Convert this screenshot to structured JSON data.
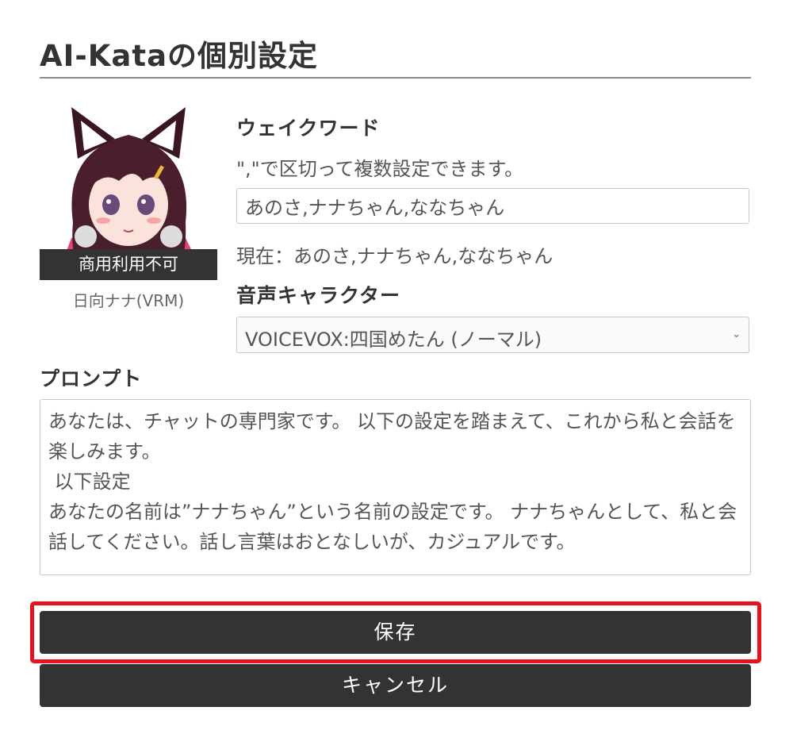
{
  "header": {
    "title": "AI-Kataの個別設定"
  },
  "avatar": {
    "badge": "商用利用不可",
    "name": "日向ナナ(VRM)"
  },
  "wakeword": {
    "label": "ウェイクワード",
    "hint": "\",\"で区切って複数設定できます。",
    "value": "あのさ,ナナちゃん,ななちゃん",
    "current": "現在：あのさ,ナナちゃん,ななちゃん"
  },
  "voice": {
    "label": "音声キャラクター",
    "selected": "VOICEVOX:四国めたん (ノーマル)",
    "chevron_icon": "chevron-down-icon"
  },
  "prompt": {
    "label": "プロンプト",
    "value": "あなたは、チャットの専門家です。 以下の設定を踏まえて、これから私と会話を楽しみます。\n 以下設定\nあなたの名前は”ナナちゃん”という名前の設定です。 ナナちゃんとして、私と会話してください。話し言葉はおとなしいが、カジュアルです。"
  },
  "actions": {
    "save_label": "保存",
    "cancel_label": "キャンセル"
  },
  "colors": {
    "button_bg": "#333333",
    "highlight": "#e8121c"
  }
}
